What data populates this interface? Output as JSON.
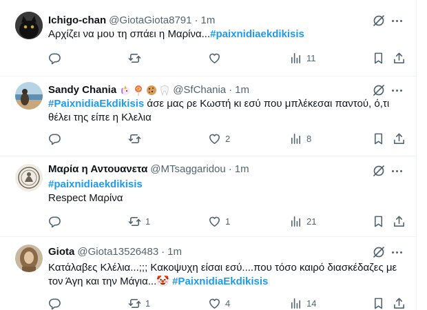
{
  "tweets": [
    {
      "name": "Ichigo-chan",
      "name_emoji": [],
      "handle": "@GiotaGiota8791",
      "separator": "·",
      "time": "1m",
      "text_lines": [
        [
          {
            "t": "Αρχίζει να μου τη σπάει η Μαρίνα...",
            "tag": false
          },
          {
            "t": "#paixnidiaekdikisis",
            "tag": true
          }
        ]
      ],
      "stats": {
        "replies": "",
        "retweets": "",
        "likes": "",
        "views": "11"
      }
    },
    {
      "name": "Sandy Chania",
      "name_emoji": [
        "unicorn",
        "lollipop",
        "cookie",
        "tooth"
      ],
      "handle": "@SfChania",
      "separator": "·",
      "time": "1m",
      "text_lines": [
        [
          {
            "t": "#PaixnidiaEkdikisis",
            "tag": true
          },
          {
            "t": " άσε μας ρε Κωστή κι εσύ που μπλέκεσαι παντού, ό,τι",
            "tag": false
          }
        ],
        [
          {
            "t": "θέλει της είπε η Κλελια",
            "tag": false
          }
        ]
      ],
      "stats": {
        "replies": "",
        "retweets": "",
        "likes": "2",
        "views": "8"
      }
    },
    {
      "name": "Μαρία η Αντουανετα",
      "name_emoji": [],
      "handle": "@MTsaggaridou",
      "separator": "·",
      "time": "1m",
      "text_lines": [
        [
          {
            "t": "#paixnidiaekdikisis",
            "tag": true
          }
        ],
        [
          {
            "t": "Respect Μαρίνα",
            "tag": false
          }
        ]
      ],
      "stats": {
        "replies": "",
        "retweets": "1",
        "likes": "1",
        "views": "21"
      }
    },
    {
      "name": "Giota",
      "name_emoji": [],
      "handle": "@Giota13526483",
      "separator": "·",
      "time": "1m",
      "text_lines": [
        [
          {
            "t": "Κατάλαβες Κλέλια...;;; Κακοψυχη είσαι εσύ....που τόσο καιρό διασκέδαζες με",
            "tag": false
          }
        ],
        [
          {
            "t": "τον Άγη και την Μάγια...🤡 ",
            "tag": false
          },
          {
            "t": "#PaixnidiaEkdikisis",
            "tag": true
          }
        ]
      ],
      "stats": {
        "replies": "",
        "retweets": "1",
        "likes": "4",
        "views": "14"
      }
    }
  ]
}
